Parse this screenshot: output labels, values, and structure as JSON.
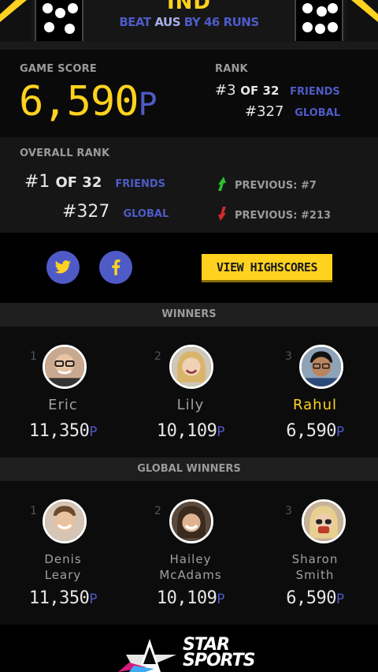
{
  "header": {
    "team": "IND",
    "result_prefix": "BEAT",
    "result_team": "AUS",
    "result_suffix": "BY 46 RUNS"
  },
  "score": {
    "label": "GAME SCORE",
    "value": "6,590",
    "unit": "P"
  },
  "rank": {
    "label": "RANK",
    "friends_pos": "#3",
    "friends_of": "OF 32",
    "friends_label": "FRIENDS",
    "global_pos": "#327",
    "global_label": "GLOBAL"
  },
  "overall": {
    "label": "OVERALL RANK",
    "friends_pos": "#1",
    "friends_of": "OF 32",
    "friends_label": "FRIENDS",
    "global_pos": "#327",
    "global_label": "GLOBAL",
    "previous_friends": "PREVIOUS: #7",
    "previous_global": "PREVIOUS: #213"
  },
  "share": {
    "highscores_label": "VIEW HIGHSCORES"
  },
  "winners": {
    "title": "WINNERS",
    "items": [
      {
        "pos": "1",
        "name": "Eric",
        "score": "11,350",
        "unit": "P"
      },
      {
        "pos": "2",
        "name": "Lily",
        "score": "10,109",
        "unit": "P"
      },
      {
        "pos": "3",
        "name": "Rahul",
        "score": "6,590",
        "unit": "P"
      }
    ]
  },
  "global_winners": {
    "title": "GLOBAL WINNERS",
    "items": [
      {
        "pos": "1",
        "name1": "Denis",
        "name2": "Leary",
        "score": "11,350",
        "unit": "P"
      },
      {
        "pos": "2",
        "name1": "Hailey",
        "name2": "McAdams",
        "score": "10,109",
        "unit": "P"
      },
      {
        "pos": "3",
        "name1": "Sharon",
        "name2": "Smith",
        "score": "6,590",
        "unit": "P"
      }
    ]
  },
  "footer": {
    "brand_line1": "STAR",
    "brand_line2": "SPORTS"
  },
  "colors": {
    "accent_yellow": "#ffd21f",
    "accent_blue": "#4e5bc7",
    "up_green": "#2fbf2f",
    "down_red": "#d42a2a"
  },
  "icons": [
    "twitter-icon",
    "facebook-icon",
    "arrow-up-icon",
    "arrow-down-icon",
    "dice-icon"
  ]
}
